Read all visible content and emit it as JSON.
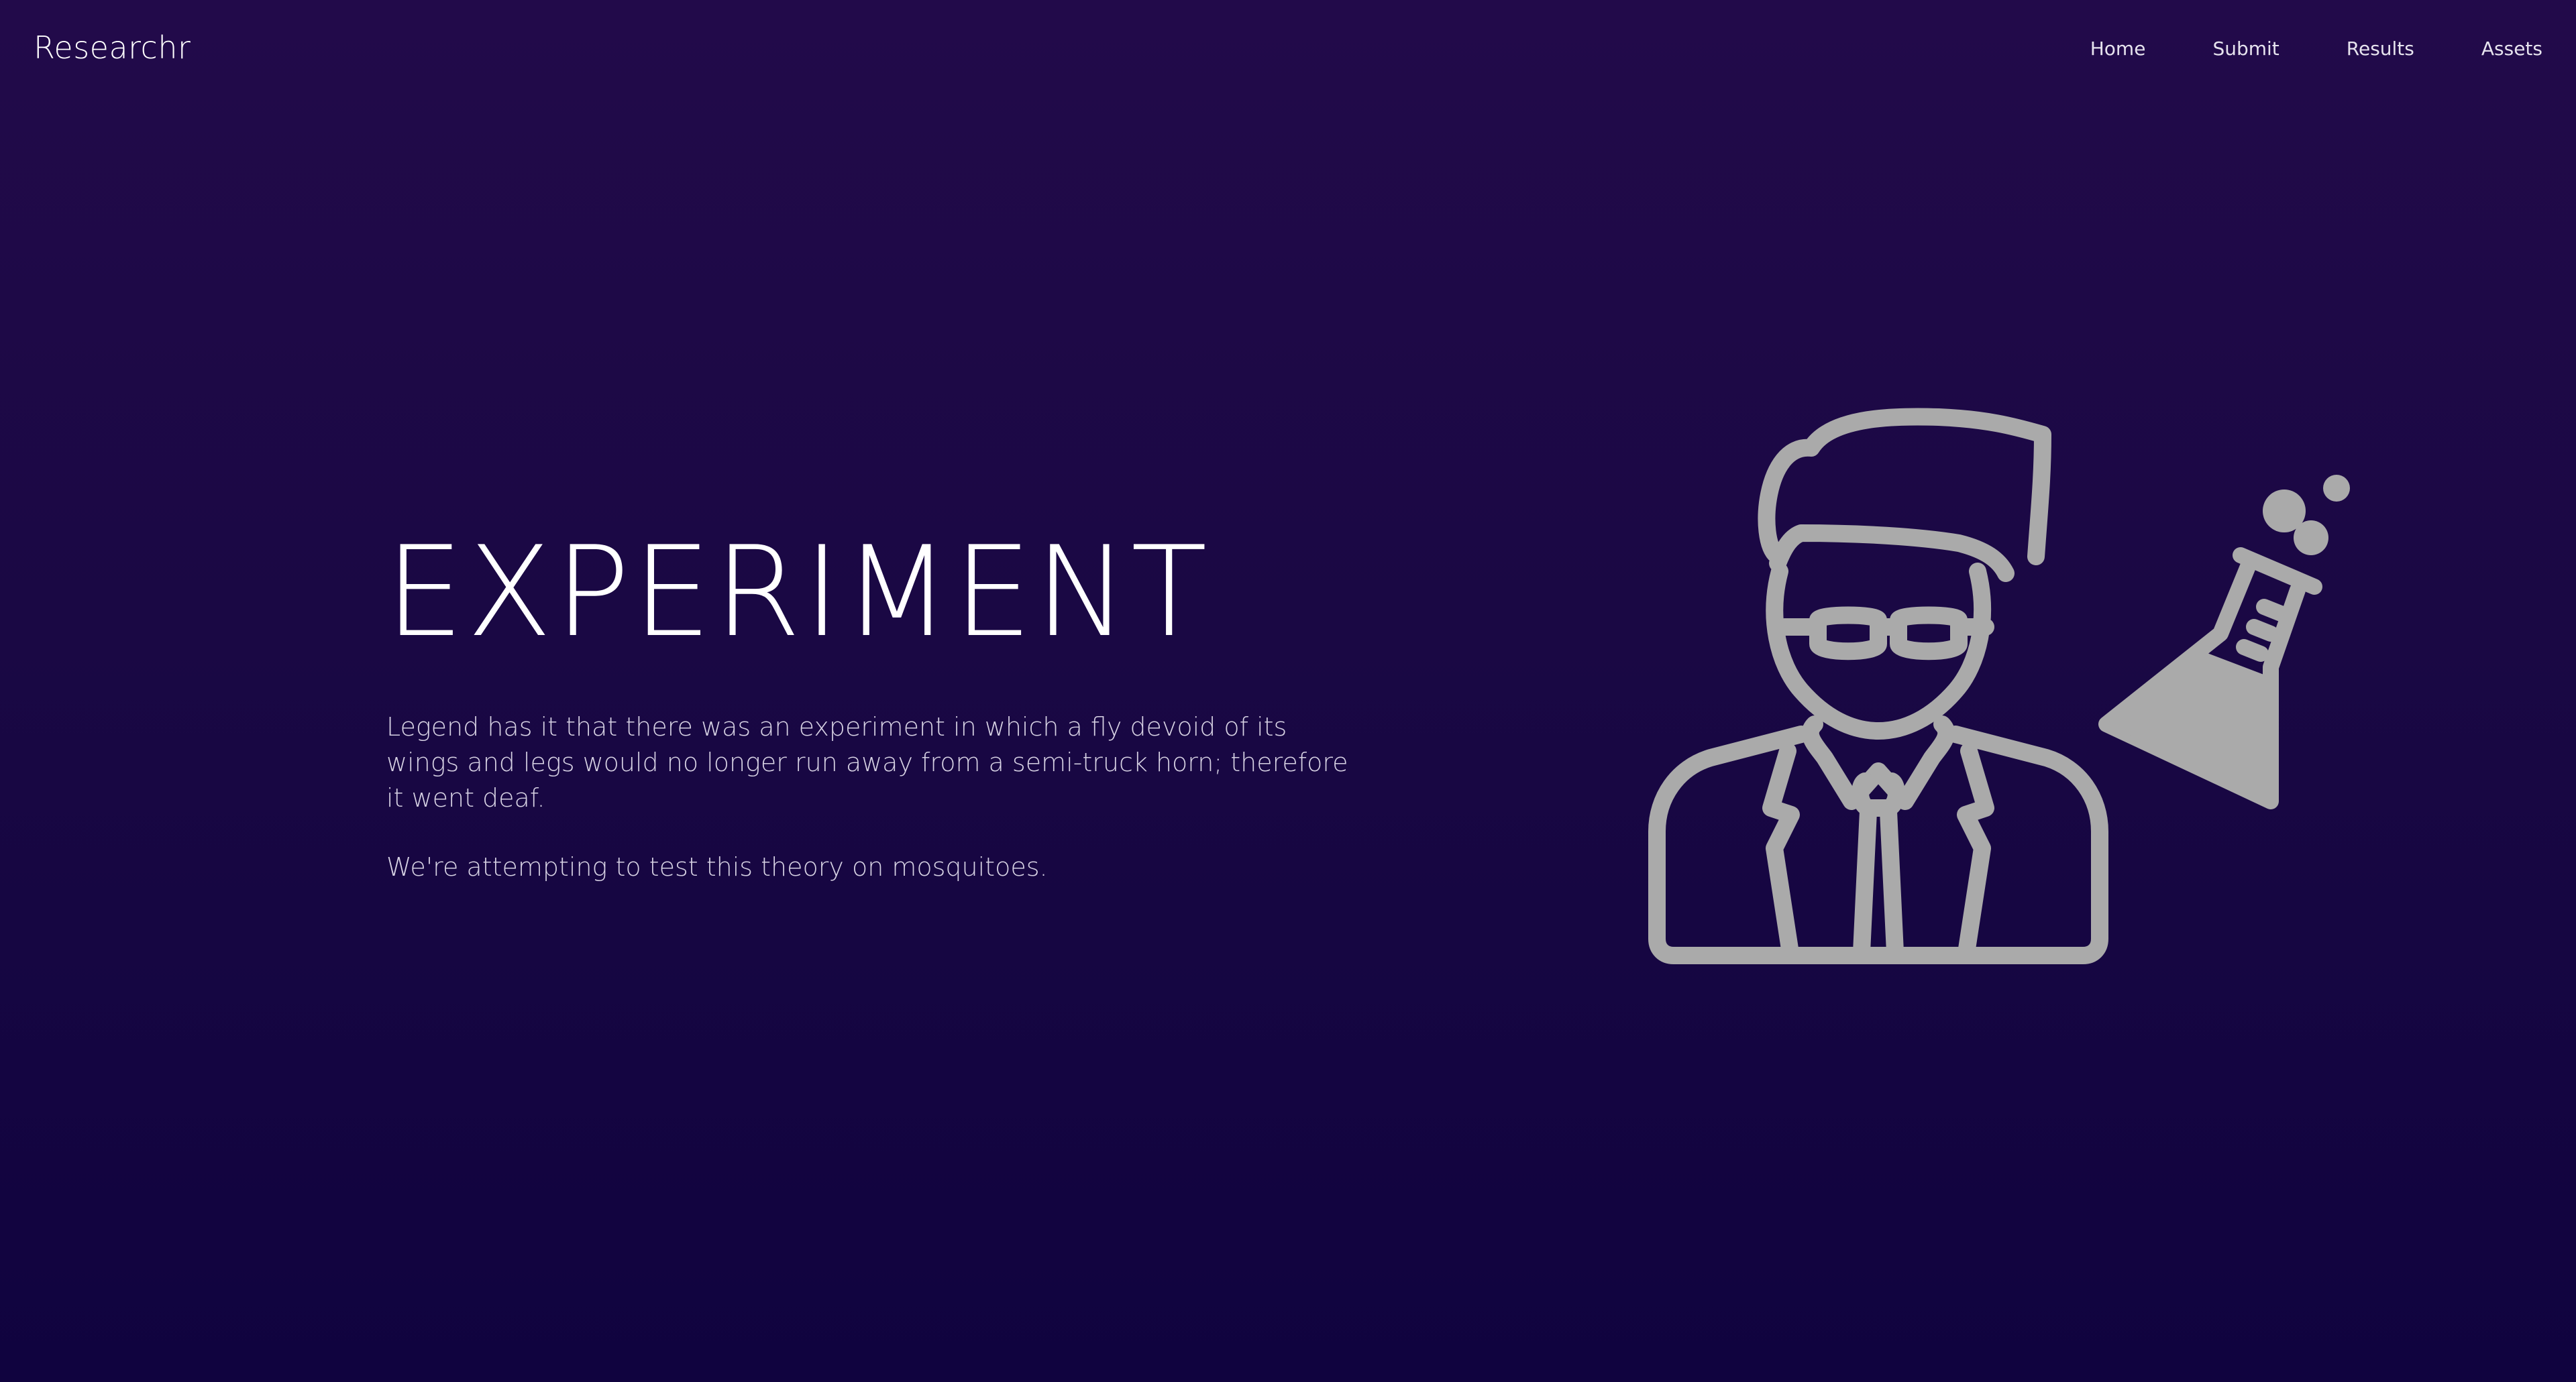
{
  "brand": {
    "name": "Researchr"
  },
  "nav": {
    "items": [
      {
        "label": "Home"
      },
      {
        "label": "Submit"
      },
      {
        "label": "Results"
      },
      {
        "label": "Assets"
      }
    ]
  },
  "hero": {
    "title": "EXPERIMENT",
    "paragraph_1": "Legend has it that there was an experiment in which a fly devoid of its wings and legs would no longer run away from a semi-truck horn; therefore it went deaf.",
    "paragraph_2": "We're attempting to test this theory on mosquitoes.",
    "illustration_icon": "scientist-with-flask-icon"
  },
  "colors": {
    "background_top": "#220a4a",
    "background_bottom": "#10033f",
    "text_primary": "#ffffff",
    "text_secondary": "#d7d2e4",
    "illustration": "#aaaaaa"
  }
}
